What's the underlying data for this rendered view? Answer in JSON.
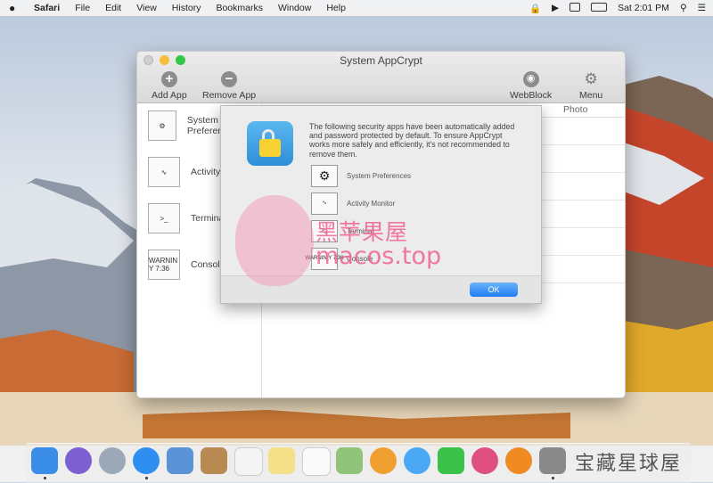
{
  "menubar": {
    "app_name": "Safari",
    "items": [
      "File",
      "Edit",
      "View",
      "History",
      "Bookmarks",
      "Window",
      "Help"
    ],
    "clock": "Sat 2:01 PM"
  },
  "window": {
    "title": "System AppCrypt",
    "toolbar": {
      "add_app": "Add App",
      "remove_app": "Remove App",
      "webblock": "WebBlock",
      "menu": "Menu"
    },
    "column_header": "Photo",
    "sidebar": [
      {
        "label": "System Preferences",
        "icon": "gear-icon"
      },
      {
        "label": "Activity Monitor",
        "icon": "activity-icon"
      },
      {
        "label": "Terminal",
        "icon": "terminal-icon"
      },
      {
        "label": "Console",
        "icon": "console-icon",
        "icon_text": "WARNIN Y 7:36"
      }
    ]
  },
  "dialog": {
    "message": "The following security apps have been automatically added and password protected by default. To ensure AppCrypt works more safely and efficiently, it's not recommended to remove them.",
    "apps": [
      {
        "label": "System Preferences",
        "icon": "gear-icon"
      },
      {
        "label": "Activity Monitor",
        "icon": "activity-icon"
      },
      {
        "label": "Terminal",
        "icon": "terminal-icon"
      },
      {
        "label": "Console",
        "icon": "console-icon",
        "icon_text": "WARNIN Y 7:36"
      }
    ],
    "ok_label": "OK"
  },
  "watermark": {
    "line1": "黑苹果屋",
    "line2": "macos.top",
    "corner": "宝藏星球屋"
  },
  "dock_apps": [
    "Finder",
    "Siri",
    "Launchpad",
    "Safari",
    "Mail",
    "Contacts",
    "Calendar",
    "Notes",
    "Reminders",
    "Maps",
    "Photos",
    "Messages",
    "FaceTime",
    "iTunes",
    "iBooks",
    "System Preferences"
  ],
  "colors": {
    "accent": "#1e7ef3",
    "close": "#cfcfcf",
    "minimize": "#f5bf3b",
    "zoom": "#33c748"
  }
}
